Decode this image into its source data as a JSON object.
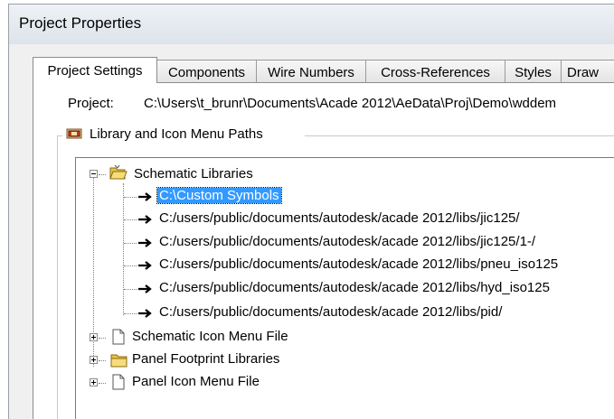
{
  "window": {
    "title": "Project Properties"
  },
  "tabs": [
    {
      "label": "Project Settings",
      "active": true
    },
    {
      "label": "Components",
      "active": false
    },
    {
      "label": "Wire Numbers",
      "active": false
    },
    {
      "label": "Cross-References",
      "active": false
    },
    {
      "label": "Styles",
      "active": false
    },
    {
      "label": "Draw",
      "active": false
    }
  ],
  "project": {
    "label": "Project:",
    "path": "C:\\Users\\t_brunr\\Documents\\Acade 2012\\AeData\\Proj\\Demo\\wddem"
  },
  "group": {
    "label": "Library and Icon Menu Paths"
  },
  "tree": {
    "schematic_libraries": {
      "label": "Schematic Libraries",
      "expanded": true,
      "paths": [
        {
          "label": "C:\\Custom Symbols",
          "selected": true
        },
        {
          "label": "C:/users/public/documents/autodesk/acade 2012/libs/jic125/",
          "selected": false
        },
        {
          "label": "C:/users/public/documents/autodesk/acade 2012/libs/jic125/1-/",
          "selected": false
        },
        {
          "label": "C:/users/public/documents/autodesk/acade 2012/libs/pneu_iso125",
          "selected": false
        },
        {
          "label": "C:/users/public/documents/autodesk/acade 2012/libs/hyd_iso125",
          "selected": false
        },
        {
          "label": "C:/users/public/documents/autodesk/acade 2012/libs/pid/",
          "selected": false
        }
      ]
    },
    "schematic_icon_menu_file": {
      "label": "Schematic Icon Menu File",
      "expanded": false
    },
    "panel_footprint_libraries": {
      "label": "Panel Footprint Libraries",
      "expanded": false
    },
    "panel_icon_menu_file": {
      "label": "Panel Icon Menu File",
      "expanded": false
    }
  },
  "colors": {
    "selection": "#3399ff",
    "folder": "#f5d76e",
    "window_bg": "#f0f0f0"
  }
}
